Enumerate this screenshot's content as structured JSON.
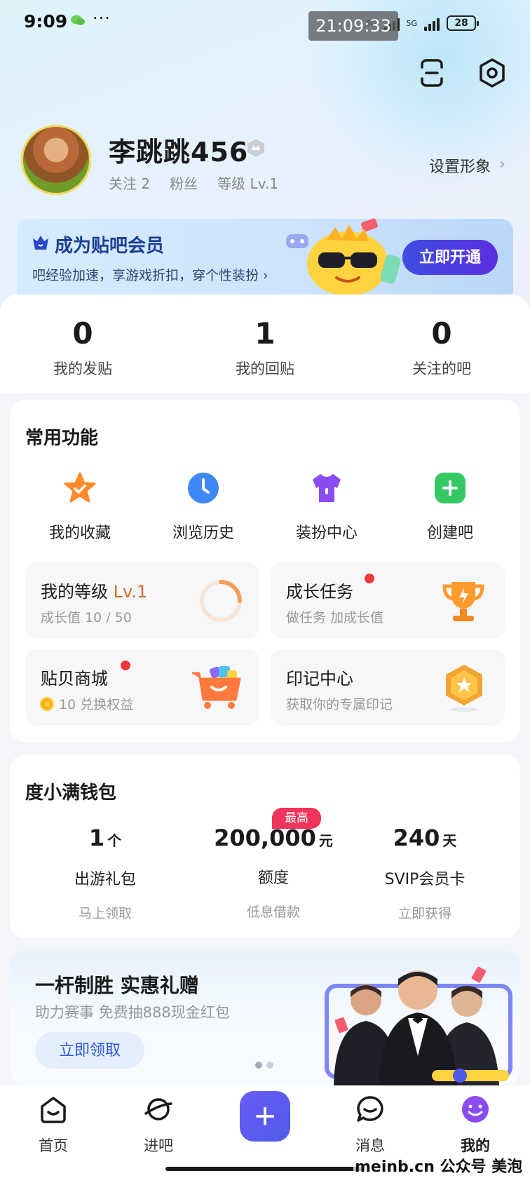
{
  "status_bar": {
    "time": "9:09",
    "more": "···",
    "network_1": "5G",
    "network_2": "5G",
    "battery": "28",
    "clock_overlay": "21:09:33"
  },
  "header": {
    "scan_icon": "scan-icon",
    "settings_icon": "settings-icon"
  },
  "profile": {
    "username": "李跳跳456",
    "following": "关注 2",
    "fans": "粉丝",
    "level": "等级 Lv.1",
    "set_avatar": "设置形象",
    "chevron": "›"
  },
  "vip": {
    "title": "成为贴吧会员",
    "subtitle": "吧经验加速，享游戏折扣，穿个性装扮 ›",
    "button": "立即开通"
  },
  "post_stats": [
    {
      "value": "0",
      "label": "我的发贴"
    },
    {
      "value": "1",
      "label": "我的回贴"
    },
    {
      "value": "0",
      "label": "关注的吧"
    }
  ],
  "common_functions": {
    "title": "常用功能",
    "items": [
      {
        "label": "我的收藏",
        "icon": "star-icon"
      },
      {
        "label": "浏览历史",
        "icon": "clock-icon"
      },
      {
        "label": "装扮中心",
        "icon": "shirt-icon"
      },
      {
        "label": "创建吧",
        "icon": "plus-icon"
      }
    ],
    "tiles": {
      "level": {
        "title": "我的等级",
        "level": "Lv.1",
        "sub": "成长值 10 / 50"
      },
      "growth": {
        "title": "成长任务",
        "sub": "做任务 加成长值"
      },
      "shop": {
        "title": "贴贝商城",
        "sub": "10 兑换权益"
      },
      "badge": {
        "title": "印记中心",
        "sub": "获取你的专属印记"
      }
    }
  },
  "wallet": {
    "title": "度小满钱包",
    "top_badge": "最高",
    "items": [
      {
        "value": "1",
        "unit": "个",
        "name": "出游礼包",
        "sub": "马上领取"
      },
      {
        "value": "200,000",
        "unit": "元",
        "name": "额度",
        "sub": "低息借款"
      },
      {
        "value": "240",
        "unit": "天",
        "name": "SVIP会员卡",
        "sub": "立即获得"
      }
    ]
  },
  "promo": {
    "title": "一杆制胜 实惠礼赠",
    "subtitle": "助力赛事 免费抽888现金红包",
    "button": "立即领取"
  },
  "bottom_nav": {
    "items": [
      {
        "label": "首页"
      },
      {
        "label": "进吧"
      },
      {
        "label": "消息"
      },
      {
        "label": "我的"
      }
    ],
    "plus": "+"
  },
  "watermark": "meinb.cn  公众号 美泡君",
  "colors": {
    "accent": "#4f5ae8",
    "vip_blue": "#1a3e96",
    "level_orange": "#d46b2a",
    "red_dot": "#f03a3a"
  }
}
